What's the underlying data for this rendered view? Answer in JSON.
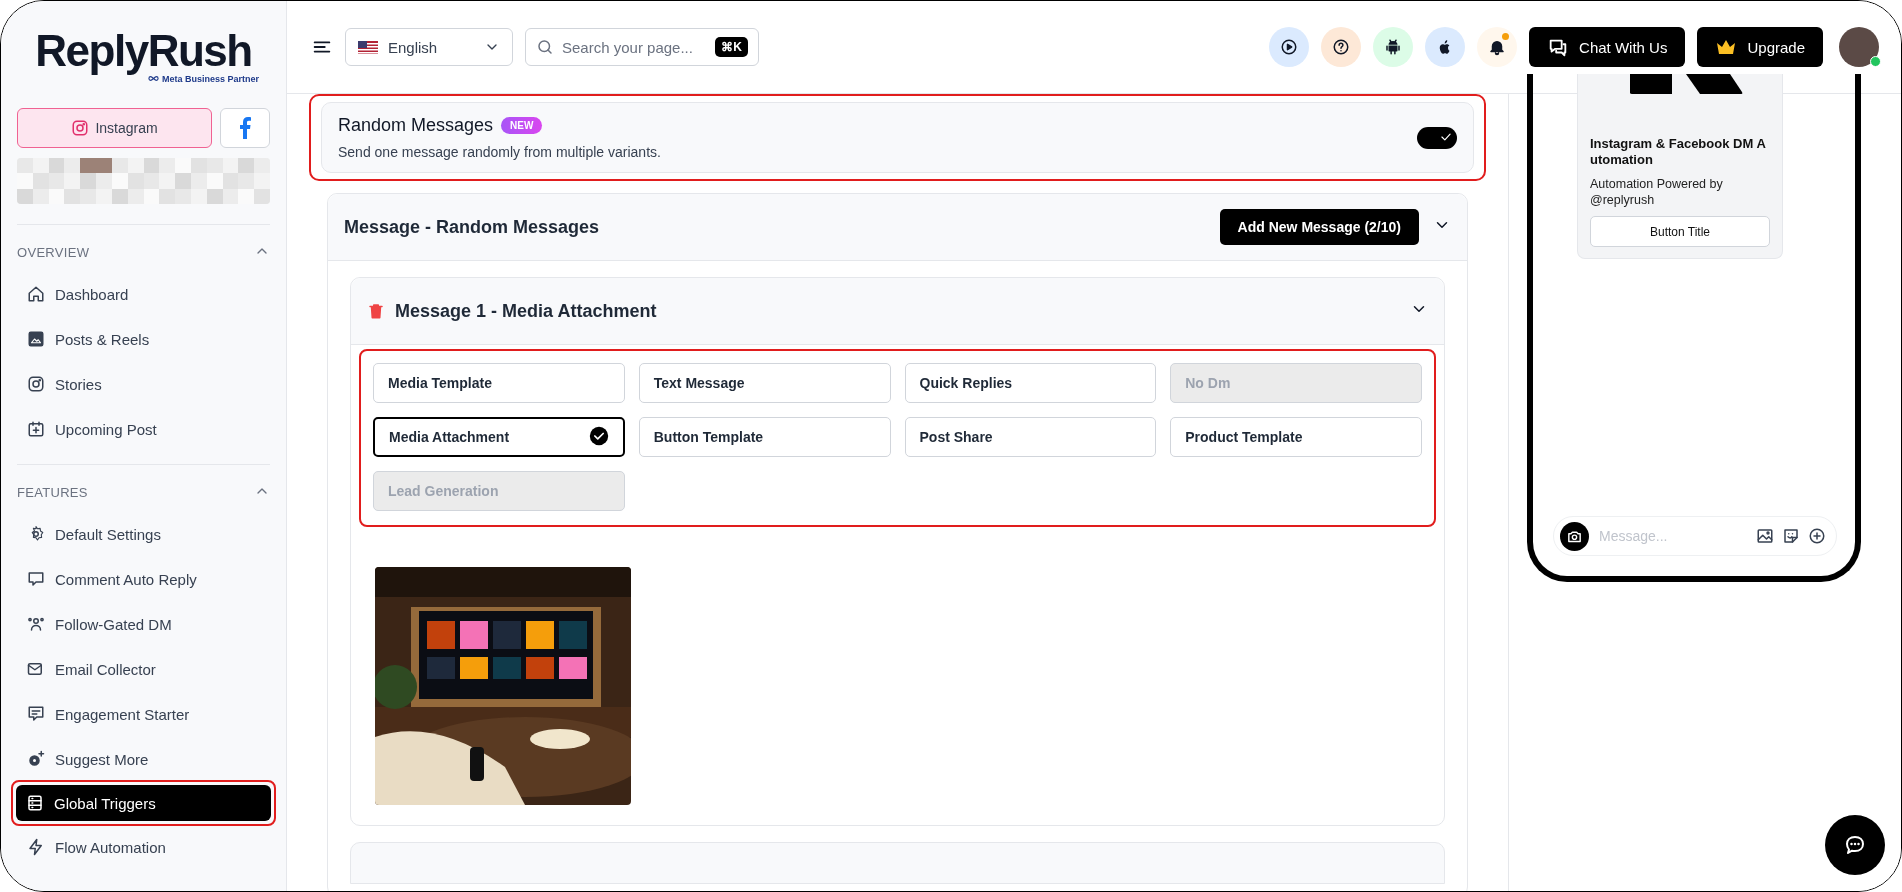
{
  "brand": {
    "name": "ReplyRush",
    "tagline": "Meta Business Partner"
  },
  "platforms": [
    {
      "kind": "instagram",
      "label": "Instagram",
      "selected": true
    },
    {
      "kind": "facebook",
      "selected": false
    }
  ],
  "sidebar": {
    "sections": [
      {
        "title": "OVERVIEW",
        "expanded": true,
        "items": [
          {
            "label": "Dashboard",
            "selected": false,
            "highlighted": false
          },
          {
            "label": "Posts & Reels",
            "selected": false,
            "highlighted": false
          },
          {
            "label": "Stories",
            "selected": false,
            "highlighted": false
          },
          {
            "label": "Upcoming Post",
            "selected": false,
            "highlighted": false
          }
        ]
      },
      {
        "title": "FEATURES",
        "expanded": true,
        "items": [
          {
            "label": "Default Settings",
            "selected": false,
            "highlighted": false
          },
          {
            "label": "Comment Auto Reply",
            "selected": false,
            "highlighted": false
          },
          {
            "label": "Follow-Gated DM",
            "selected": false,
            "highlighted": false
          },
          {
            "label": "Email Collector",
            "selected": false,
            "highlighted": false
          },
          {
            "label": "Engagement Starter",
            "selected": false,
            "highlighted": false
          },
          {
            "label": "Suggest More",
            "selected": false,
            "highlighted": false
          },
          {
            "label": "Global Triggers",
            "selected": true,
            "highlighted": true
          },
          {
            "label": "Flow Automation",
            "selected": false,
            "highlighted": false
          }
        ]
      }
    ]
  },
  "topbar": {
    "language": "English",
    "search_placeholder": "Search your page...",
    "shortcut": "⌘K",
    "unread_notifications": true,
    "chat_button": "Chat With Us",
    "upgrade_button": "Upgrade",
    "online": true
  },
  "random_messages": {
    "title": "Random Messages",
    "badge": "NEW",
    "description": "Send one message randomly from multiple variants.",
    "on": true,
    "highlighted": true
  },
  "message_group": {
    "title": "Message - Random Messages",
    "add_button": "Add New Message (2/10)",
    "expanded": true,
    "messages": [
      {
        "title": "Message 1 - Media Attachment",
        "expanded": true,
        "types_highlighted": true,
        "types": [
          {
            "label": "Media Template",
            "selected": false,
            "disabled": false
          },
          {
            "label": "Text Message",
            "selected": false,
            "disabled": false
          },
          {
            "label": "Quick Replies",
            "selected": false,
            "disabled": false
          },
          {
            "label": "No Dm",
            "selected": false,
            "disabled": true
          },
          {
            "label": "Media Attachment",
            "selected": true,
            "disabled": false
          },
          {
            "label": "Button Template",
            "selected": false,
            "disabled": false
          },
          {
            "label": "Post Share",
            "selected": false,
            "disabled": false
          },
          {
            "label": "Product Template",
            "selected": false,
            "disabled": false
          },
          {
            "label": "Lead Generation",
            "selected": false,
            "disabled": true
          }
        ]
      }
    ]
  },
  "preview": {
    "card_title": "Instagram & Facebook DM Automation",
    "card_subtitle": "Automation Powered by @replyrush",
    "card_button": "Button Title",
    "composer_placeholder": "Message..."
  }
}
